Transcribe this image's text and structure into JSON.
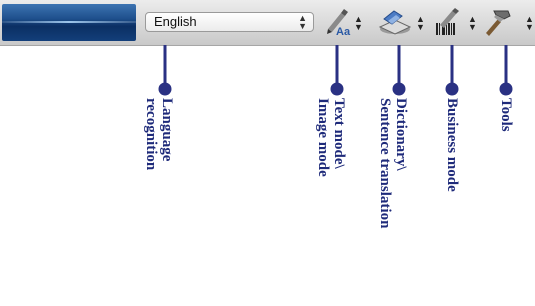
{
  "language_select": {
    "value": "English"
  },
  "toolbar": {
    "tools": [
      {
        "icon": "text-mode-icon",
        "glyph": "Aa"
      },
      {
        "icon": "dictionary-icon"
      },
      {
        "icon": "business-mode-icon"
      },
      {
        "icon": "tools-icon"
      }
    ]
  },
  "annotations": {
    "language": "Language\nrecognition",
    "text_mode": "Text mode\\\nImage mode",
    "dictionary": "Dictionary\\\nSentence translation",
    "business": "Business mode",
    "tools": "Tools"
  },
  "colors": {
    "pointer": "#2a3183",
    "brand": "#1e4f8c"
  }
}
